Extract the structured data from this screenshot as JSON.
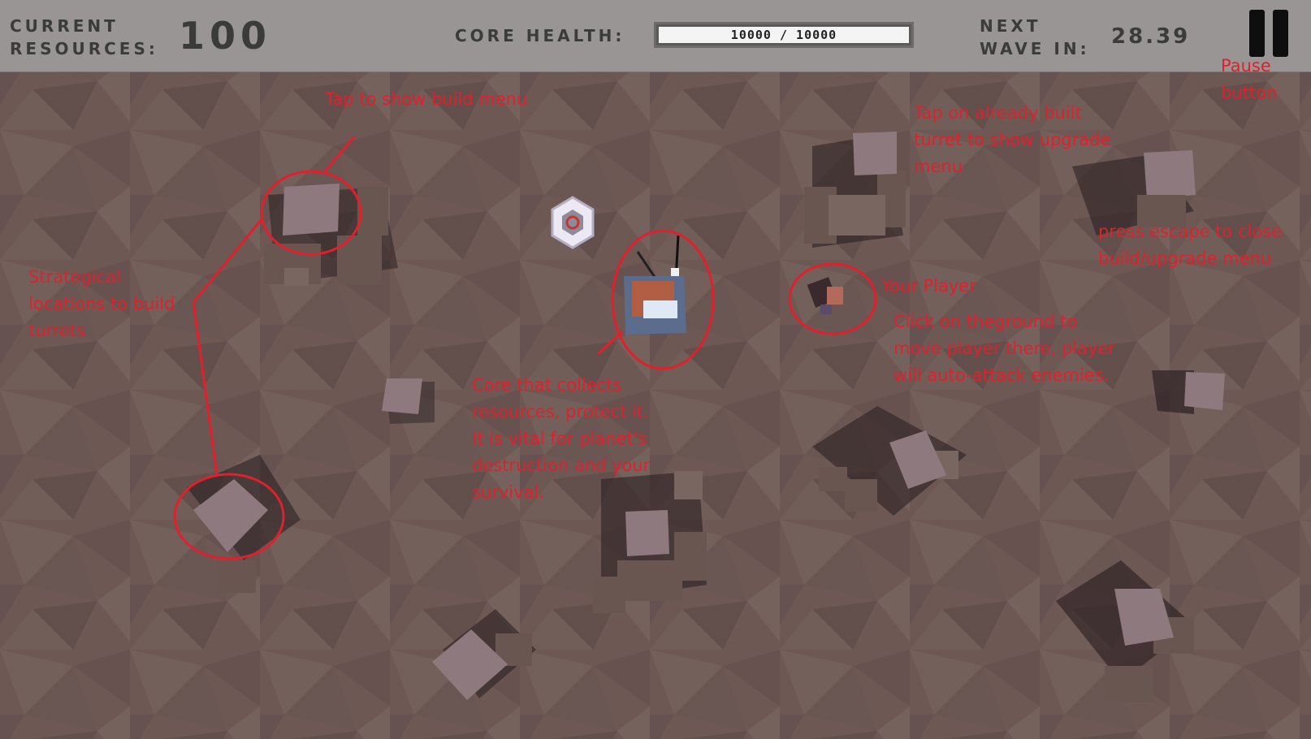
{
  "hud": {
    "resources_label_line1": "CURRENT",
    "resources_label_line2": "RESOURCES:",
    "resources_value": "100",
    "core_health_label": "CORE HEALTH:",
    "core_health_text": "10000 / 10000",
    "core_health_fraction": 1.0,
    "wave_label_line1": "NEXT",
    "wave_label_line2": "WAVE IN:",
    "wave_timer": "28.39"
  },
  "annotations": {
    "pause_line1": "Pause",
    "pause_line2": "button",
    "build_menu": "Tap to show build menu",
    "upgrade_line1": "Tap on already built",
    "upgrade_line2": "turret to show upgrade",
    "upgrade_line3": "menu",
    "escape_line1": "press escape to close",
    "escape_line2": "build/upgrade menu",
    "strategic_line1": "Strategical",
    "strategic_line2": "locations to build",
    "strategic_line3": "turrets",
    "player": "Your Player",
    "move_line1": "Click on theground to",
    "move_line2": "move player there, player",
    "move_line3": "will auto-attack enemies.",
    "core_line1": "Core that collects",
    "core_line2": "resources, protect it.",
    "core_line3": "It is vital for planet's",
    "core_line4": "destruction and your",
    "core_line5": "survival."
  },
  "colors": {
    "ground": "#6e5854",
    "hud_bg": "#9a9595",
    "hud_text": "#3b3b3b",
    "annotation_red": "#e0202a",
    "block_top": "#8e7a7e",
    "block_side": "#6a5650",
    "block_shadow": "#2c2123"
  }
}
